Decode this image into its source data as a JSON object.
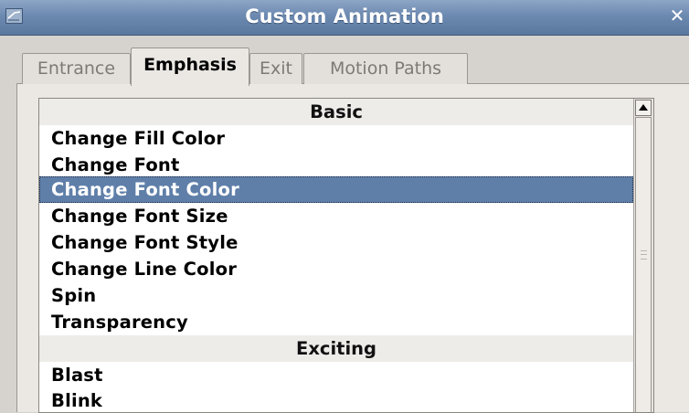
{
  "window": {
    "title": "Custom Animation",
    "close_label": "✕"
  },
  "tabs": [
    {
      "label": "Entrance",
      "active": false
    },
    {
      "label": "Emphasis",
      "active": true
    },
    {
      "label": "Exit",
      "active": false
    },
    {
      "label": "Motion Paths",
      "active": false
    }
  ],
  "list": {
    "rows": [
      {
        "kind": "header",
        "label": "Basic"
      },
      {
        "kind": "item",
        "label": "Change Fill Color"
      },
      {
        "kind": "item",
        "label": "Change Font"
      },
      {
        "kind": "item",
        "label": "Change Font Color",
        "selected": true
      },
      {
        "kind": "item",
        "label": "Change Font Size"
      },
      {
        "kind": "item",
        "label": "Change Font Style"
      },
      {
        "kind": "item",
        "label": "Change Line Color"
      },
      {
        "kind": "item",
        "label": "Spin"
      },
      {
        "kind": "item",
        "label": "Transparency"
      },
      {
        "kind": "header",
        "label": "Exciting"
      },
      {
        "kind": "item",
        "label": "Blast"
      },
      {
        "kind": "item",
        "label": "Blink"
      }
    ]
  },
  "colors": {
    "selection": "#5f7fa9",
    "titlebar": "#6c89b0"
  },
  "icons": {
    "app": "window-menu-icon",
    "close": "close-icon",
    "scroll_up": "scroll-up-arrow-icon"
  }
}
